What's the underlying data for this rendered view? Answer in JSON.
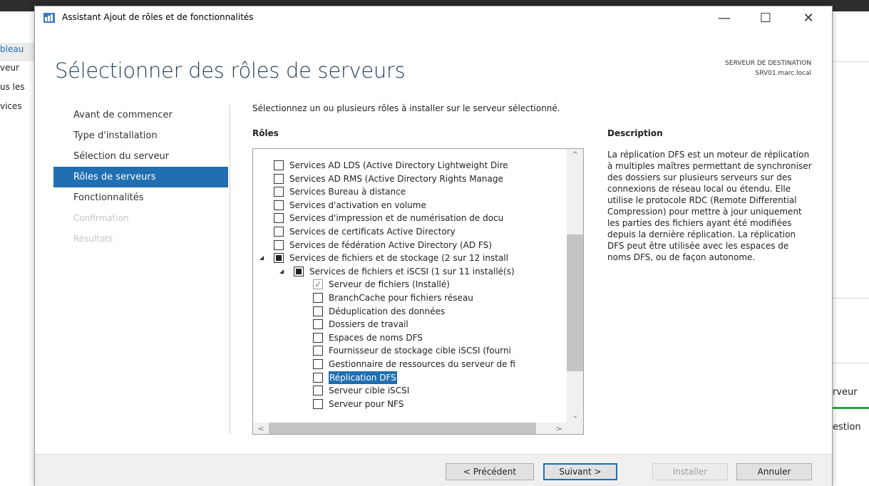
{
  "background": {
    "left_items": [
      "bleau",
      "veur",
      "us les",
      "vices"
    ],
    "right_items": [
      "rveur",
      "estion"
    ]
  },
  "window": {
    "title": "Assistant Ajout de rôles et de fonctionnalités",
    "controls": {
      "minimize": "—",
      "maximize": "☐",
      "close": "✕"
    }
  },
  "page": {
    "title": "Sélectionner des rôles de serveurs",
    "destination_label": "SERVEUR DE DESTINATION",
    "destination_server": "SRV01.marc.local"
  },
  "nav": [
    {
      "label": "Avant de commencer",
      "state": "normal"
    },
    {
      "label": "Type d'installation",
      "state": "normal"
    },
    {
      "label": "Sélection du serveur",
      "state": "normal"
    },
    {
      "label": "Rôles de serveurs",
      "state": "active"
    },
    {
      "label": "Fonctionnalités",
      "state": "normal"
    },
    {
      "label": "Confirmation",
      "state": "disabled"
    },
    {
      "label": "Résultats",
      "state": "disabled"
    }
  ],
  "content": {
    "instruction": "Sélectionnez un ou plusieurs rôles à installer sur le serveur sélectionné.",
    "roles_header": "Rôles",
    "description_header": "Description",
    "description": "La réplication DFS est un moteur de réplication à multiples maîtres permettant de synchroniser des dossiers sur plusieurs serveurs sur des connexions de réseau local ou étendu. Elle utilise le protocole RDC (Remote Differential Compression) pour mettre à jour uniquement les parties des fichiers ayant été modifiées depuis la dernière réplication. La réplication DFS peut être utilisée avec les espaces de noms DFS, ou de façon autonome."
  },
  "roles": [
    {
      "label": "Services AD LDS (Active Directory Lightweight Dire",
      "level": 0,
      "state": "unchecked"
    },
    {
      "label": "Services AD RMS (Active Directory Rights Manage",
      "level": 0,
      "state": "unchecked"
    },
    {
      "label": "Services Bureau à distance",
      "level": 0,
      "state": "unchecked"
    },
    {
      "label": "Services d'activation en volume",
      "level": 0,
      "state": "unchecked"
    },
    {
      "label": "Services d'impression et de numérisation de docu",
      "level": 0,
      "state": "unchecked"
    },
    {
      "label": "Services de certificats Active Directory",
      "level": 0,
      "state": "unchecked"
    },
    {
      "label": "Services de fédération Active Directory (AD FS)",
      "level": 0,
      "state": "unchecked"
    },
    {
      "label": "Services de fichiers et de stockage (2 sur 12 install",
      "level": 0,
      "state": "partial",
      "expander": "◢"
    },
    {
      "label": "Services de fichiers et iSCSI (1 sur 11 installé(s)",
      "level": 1,
      "state": "partial",
      "expander": "◢"
    },
    {
      "label": "Serveur de fichiers (Installé)",
      "level": 2,
      "state": "checked"
    },
    {
      "label": "BranchCache pour fichiers réseau",
      "level": 2,
      "state": "unchecked"
    },
    {
      "label": "Déduplication des données",
      "level": 2,
      "state": "unchecked"
    },
    {
      "label": "Dossiers de travail",
      "level": 2,
      "state": "unchecked"
    },
    {
      "label": "Espaces de noms DFS",
      "level": 2,
      "state": "unchecked"
    },
    {
      "label": "Fournisseur de stockage cible iSCSI (fourni",
      "level": 2,
      "state": "unchecked"
    },
    {
      "label": "Gestionnaire de ressources du serveur de fi",
      "level": 2,
      "state": "unchecked"
    },
    {
      "label": "Réplication DFS",
      "level": 2,
      "state": "unchecked",
      "selected": true
    },
    {
      "label": "Serveur cible iSCSI",
      "level": 2,
      "state": "unchecked"
    },
    {
      "label": "Serveur pour NFS",
      "level": 2,
      "state": "unchecked"
    }
  ],
  "scroll_glyphs": {
    "up": "^",
    "down": "⌄",
    "left": "<",
    "right": ">"
  },
  "checkmark": "✓",
  "footer": {
    "previous": "< Précédent",
    "next": "Suivant >",
    "install": "Installer",
    "cancel": "Annuler"
  }
}
